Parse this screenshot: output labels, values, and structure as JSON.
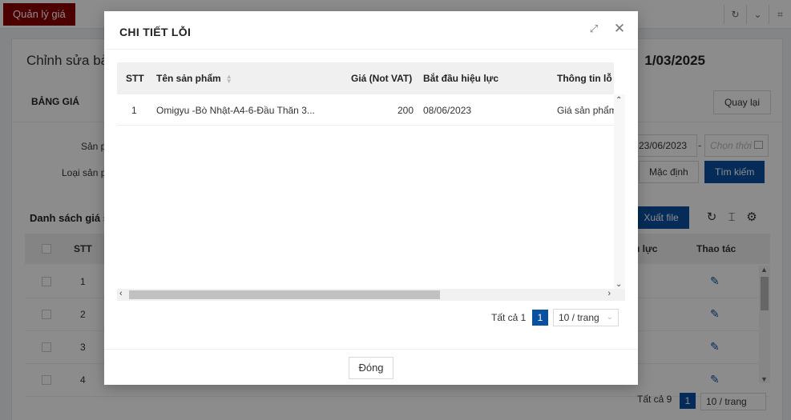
{
  "topbar": {
    "active_tab": "Quản lý giá",
    "icons": [
      "refresh-icon",
      "chevron-down-icon",
      "fullscreen-icon"
    ]
  },
  "background": {
    "page_title_left": "Chỉnh sửa bả",
    "page_title_right": "1/03/2025",
    "section_label": "BẢNG GIÁ",
    "back_button": "Quay lại",
    "filter_product_label": "Sản p",
    "filter_type_label": "Loại sản p",
    "date_from": "23/06/2023",
    "date_to_placeholder": "Chọn thời",
    "reset_button": "Mặc định",
    "search_button": "Tìm kiếm",
    "list_title": "Danh sách giá s",
    "export_button": "Xuất file",
    "table_headers": {
      "stt": "STT",
      "effective": "u lực",
      "actions": "Thao tác"
    },
    "rows": [
      "1",
      "2",
      "3",
      "4"
    ],
    "pager": {
      "total": "Tất cả 9",
      "page": "1",
      "page_size": "10 / trang"
    }
  },
  "modal": {
    "title": "CHI TIẾT LỖI",
    "columns": {
      "stt": "STT",
      "product_name": "Tên sản phẩm",
      "price": "Giá (Not VAT)",
      "start_date": "Bắt đầu hiệu lực",
      "info": "Thông tin lỗ"
    },
    "rows": [
      {
        "stt": "1",
        "product_name": "Omigyu -Bò Nhật-A4-6-Đầu Thăn 3...",
        "price": "200",
        "start_date": "08/06/2023",
        "info": "Giá sản phẩm"
      }
    ],
    "pager": {
      "total": "Tất cả 1",
      "page": "1",
      "page_size": "10 / trang"
    },
    "footer_button": "Đóng"
  }
}
